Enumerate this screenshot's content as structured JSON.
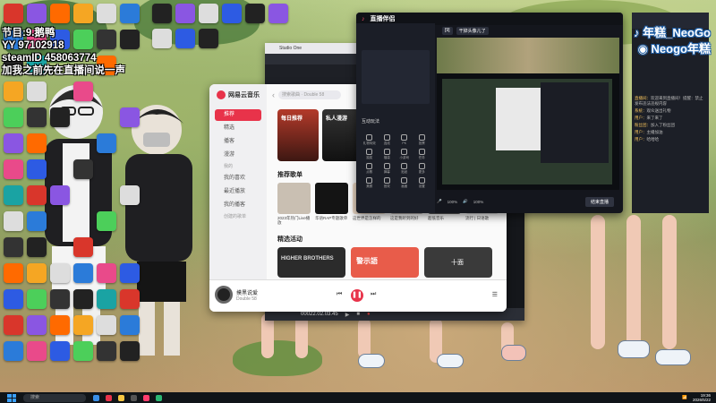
{
  "overlay": {
    "line1": "节目:9.鹅鸭",
    "line2": "YY 97102918",
    "line3": "steamID 458063774",
    "line4": "加我之前先在直播间说一声"
  },
  "brand": {
    "douyin": "年糕_NeoGo",
    "weibo": "Neogo年糕"
  },
  "desktop": {
    "icons": [
      {
        "label": "",
        "color": "#d9362b"
      },
      {
        "label": "",
        "color": "#2b7bd9"
      },
      {
        "label": "",
        "color": "#222"
      },
      {
        "label": "",
        "color": "#2c2c2c"
      },
      {
        "label": "",
        "color": "#4ccf5a"
      },
      {
        "label": "",
        "color": "#eee"
      },
      {
        "label": "",
        "color": "#ddd"
      }
    ]
  },
  "netease": {
    "app_name": "网易云音乐",
    "search_placeholder": "搜索歌曲 · Double 58",
    "nav": [
      "推荐",
      "精选",
      "播客",
      "漫游",
      "我的喜欢",
      "最近播放",
      "我的播客"
    ],
    "nav_section": "我的",
    "created_playlist": "创建的歌单",
    "cards": [
      "每日推荐",
      "私人漫游"
    ],
    "section_playlists": "推荐歌单",
    "playlists": [
      "2023年热门Live播放",
      "华语RAP专题歌单",
      "这世界是怎样的",
      "这是我听到的好",
      "超低音乐",
      "流行 | 日语歌"
    ],
    "section_events": "精选活动",
    "events": [
      "HIGHER BROTHERS",
      "警示語",
      "十面"
    ],
    "player": {
      "song": "摸黑说爱",
      "artist": "Double 58"
    }
  },
  "daw": {
    "title": "Studio One",
    "timecode": "00022.02.03.45"
  },
  "stream": {
    "app": "直播伴侣",
    "tabs": [
      "[9]",
      "干掉头像儿了"
    ],
    "section_tools": "互动玩法",
    "section_more": "直播工具",
    "tools": [
      "礼物特效",
      "连线",
      "PK",
      "投票",
      "抽奖",
      "福袋",
      "小游戏",
      "任务",
      "点歌",
      "弹幕",
      "贴纸",
      "更多",
      "美颜",
      "音效",
      "画面",
      "设置"
    ],
    "volume_left": "100%",
    "volume_right": "100%",
    "live_button": "结束直播"
  },
  "chat": {
    "lines": [
      {
        "user": "直播间",
        "text": "欢迎来到直播间！提醒：禁止发布违法违规内容"
      },
      {
        "user": "系统",
        "text": "观众送出礼物"
      },
      {
        "user": "用户",
        "text": "来了来了"
      },
      {
        "user": "粉丝团",
        "text": "加入了粉丝团"
      },
      {
        "user": "用户",
        "text": "主播加油"
      },
      {
        "user": "用户",
        "text": "哈哈哈"
      }
    ]
  },
  "taskbar": {
    "search": "搜索",
    "time": "19:36",
    "date": "2026/5/22"
  }
}
